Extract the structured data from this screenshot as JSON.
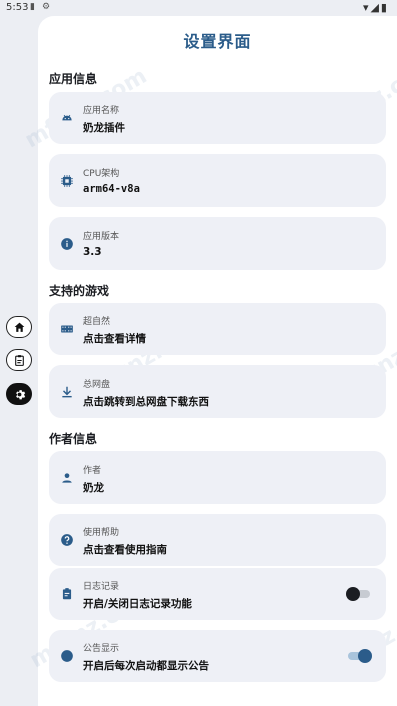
{
  "status_bar": {
    "time": "5:53"
  },
  "rail": {
    "items": [
      "home",
      "clipboard",
      "settings"
    ],
    "active": "settings"
  },
  "page": {
    "title": "设置界面"
  },
  "sections": {
    "app_info": "应用信息",
    "games": "支持的游戏",
    "author_info": "作者信息"
  },
  "cards": {
    "app_name": {
      "label": "应用名称",
      "value": "奶龙插件",
      "icon": "android-icon"
    },
    "cpu_arch": {
      "label": "CPU架构",
      "value": "arm64-v8a",
      "icon": "chip-icon"
    },
    "app_version": {
      "label": "应用版本",
      "value": "3.3",
      "icon": "info-icon"
    },
    "game_nature": {
      "label": "超自然",
      "value": "点击查看详情",
      "icon": "film-icon"
    },
    "netdisk": {
      "label": "总网盘",
      "value": "点击跳转到总网盘下载东西",
      "icon": "download-icon"
    },
    "author": {
      "label": "作者",
      "value": "奶龙",
      "icon": "person-icon"
    },
    "help": {
      "label": "使用帮助",
      "value": "点击查看使用指南",
      "icon": "help-icon"
    },
    "log": {
      "label": "日志记录",
      "value": "开启/关闭日志记录功能",
      "icon": "clipboard-icon",
      "toggle": false
    },
    "notice": {
      "label": "公告显示",
      "value": "开启后每次启动都显示公告",
      "icon": "circle-icon",
      "toggle": true
    }
  },
  "watermark": "mfunz.com",
  "colors": {
    "accent": "#2b5c8a",
    "card_bg": "#eef0f6",
    "background": "#eceef3"
  }
}
